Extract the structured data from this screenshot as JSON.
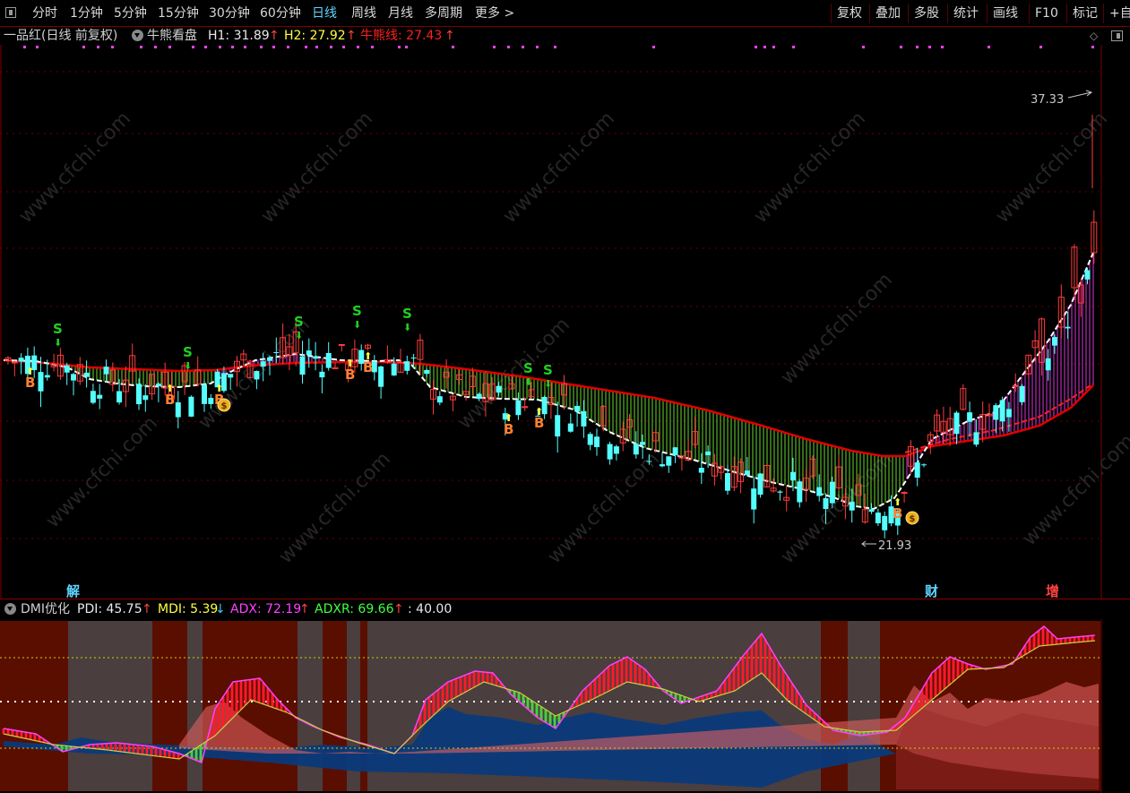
{
  "toolbar": {
    "left_tabs": [
      "分时",
      "1分钟",
      "5分钟",
      "15分钟",
      "30分钟",
      "60分钟",
      "日线",
      "周线",
      "月线",
      "多周期",
      "更多 >"
    ],
    "active_tab": "日线",
    "right_tabs": [
      "复权",
      "叠加",
      "多股",
      "统计",
      "画线",
      "F10",
      "标记",
      "+自"
    ]
  },
  "main": {
    "stock_title": "一品红(日线 前复权)",
    "indicator_name": "牛熊看盘",
    "h1_label": "H1: 31.89",
    "h2_label": "H2: 27.92",
    "bear_bull_label": "牛熊线: 27.43",
    "high_price": "37.33",
    "low_price": "21.93",
    "event_labels": {
      "jie": "解",
      "cai": "财",
      "zeng": "增"
    },
    "signal_buy": "B",
    "signal_sell": "S",
    "colors": {
      "up": "#ff3b3b",
      "down": "#54ffff",
      "bull_band": "#ff40ff",
      "bear_band": "#7dff3a",
      "bear_bull_line": "#e00000"
    }
  },
  "sub": {
    "indicator_name": "DMI优化",
    "pdi_label": "PDI: 45.75",
    "mdi_label": "MDI: 5.39",
    "adx_label": "ADX: 72.19",
    "adxr_label": "ADXR: 69.66",
    "level_label": ": 40.00"
  },
  "icons": [
    "window-icon",
    "dropdown-icon",
    "diamond-icon",
    "maximize-icon",
    "arrow-up-icon",
    "arrow-down-icon",
    "money-bag-icon"
  ]
}
